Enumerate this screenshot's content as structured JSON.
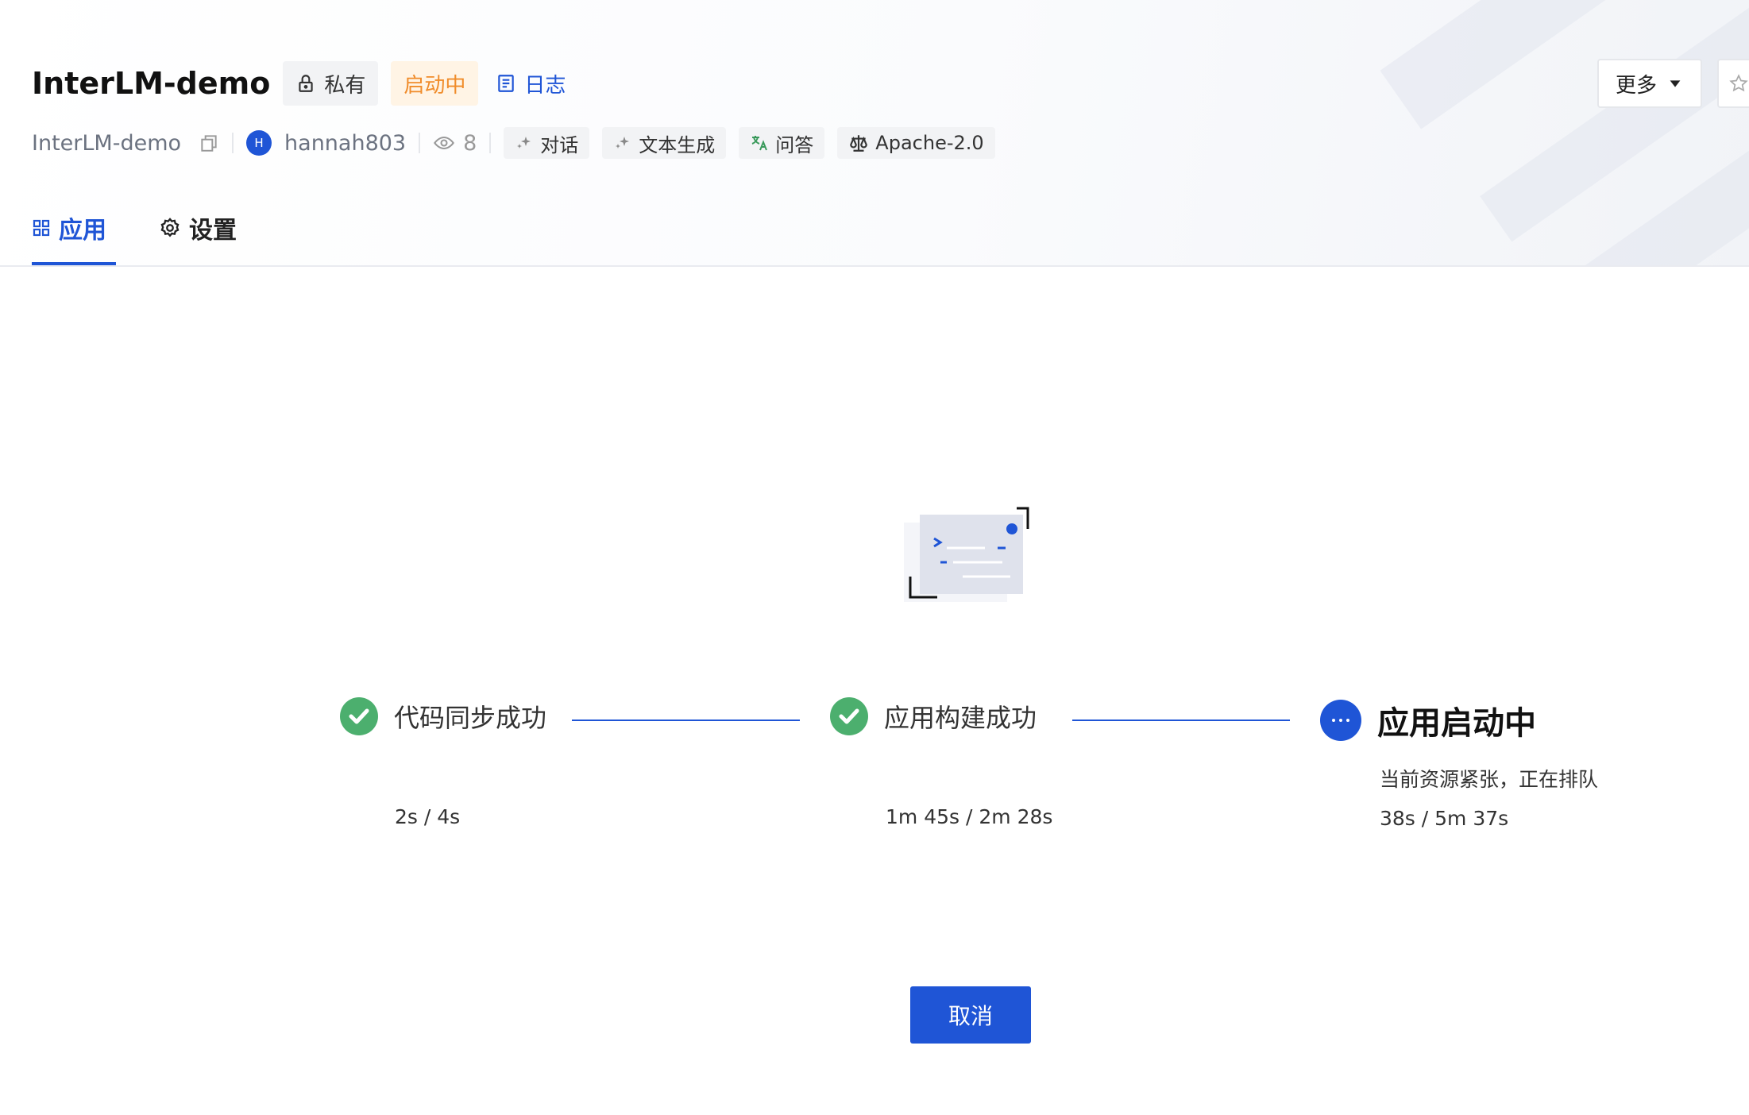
{
  "header": {
    "title": "InterLM-demo",
    "visibility_label": "私有",
    "status_label": "启动中",
    "log_label": "日志",
    "more_label": "更多"
  },
  "meta": {
    "repo_name": "InterLM-demo",
    "avatar_initial": "H",
    "username": "hannah803",
    "view_count": "8",
    "tags": [
      "对话",
      "文本生成",
      "问答"
    ],
    "license": "Apache-2.0"
  },
  "tabs": [
    {
      "label": "应用",
      "icon": "apps-icon",
      "active": true
    },
    {
      "label": "设置",
      "icon": "gear-icon",
      "active": false
    }
  ],
  "steps": [
    {
      "label": "代码同步成功",
      "status": "done",
      "time": "2s / 4s"
    },
    {
      "label": "应用构建成功",
      "status": "done",
      "time": "1m 45s / 2m 28s"
    },
    {
      "label": "应用启动中",
      "status": "in-progress",
      "subtitle": "当前资源紧张，正在排队",
      "time": "38s / 5m 37s"
    }
  ],
  "actions": {
    "cancel_label": "取消"
  },
  "colors": {
    "primary": "#1f55d6",
    "success": "#4caf6e",
    "warning": "#f08c2a"
  }
}
